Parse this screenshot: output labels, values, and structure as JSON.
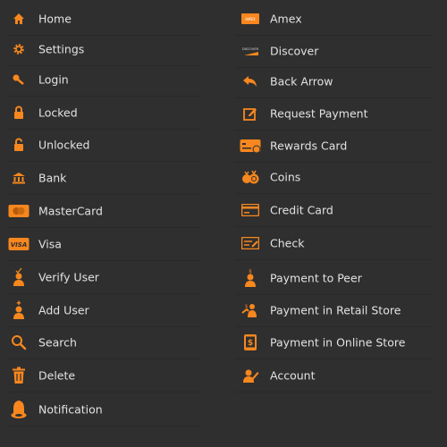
{
  "accent_color": "#f7871e",
  "left_items": [
    {
      "label": "Home",
      "icon": "home-icon"
    },
    {
      "label": "Settings",
      "icon": "gear-icon"
    },
    {
      "label": "Login",
      "icon": "key-icon"
    },
    {
      "label": "Locked",
      "icon": "lock-icon"
    },
    {
      "label": "Unlocked",
      "icon": "unlock-icon"
    },
    {
      "label": "Bank",
      "icon": "bank-icon"
    },
    {
      "label": "MasterCard",
      "icon": "mastercard-icon"
    },
    {
      "label": "Visa",
      "icon": "visa-icon"
    },
    {
      "label": "Verify User",
      "icon": "verify-user-icon"
    },
    {
      "label": "Add User",
      "icon": "add-user-icon"
    },
    {
      "label": "Search",
      "icon": "search-icon"
    },
    {
      "label": "Delete",
      "icon": "trash-icon"
    },
    {
      "label": "Notification",
      "icon": "bell-icon"
    }
  ],
  "right_items": [
    {
      "label": "Amex",
      "icon": "amex-icon"
    },
    {
      "label": "Discover",
      "icon": "discover-icon"
    },
    {
      "label": "Back Arrow",
      "icon": "back-arrow-icon"
    },
    {
      "label": "Request Payment",
      "icon": "edit-icon"
    },
    {
      "label": "Rewards Card",
      "icon": "rewards-card-icon"
    },
    {
      "label": "Coins",
      "icon": "coins-icon"
    },
    {
      "label": "Credit Card",
      "icon": "credit-card-icon"
    },
    {
      "label": "Check",
      "icon": "check-icon"
    },
    {
      "label": "Payment to Peer",
      "icon": "payment-peer-icon"
    },
    {
      "label": "Payment in Retail Store",
      "icon": "retail-payment-icon"
    },
    {
      "label": "Payment in Online Store",
      "icon": "online-payment-icon"
    },
    {
      "label": "Account",
      "icon": "account-icon"
    }
  ]
}
